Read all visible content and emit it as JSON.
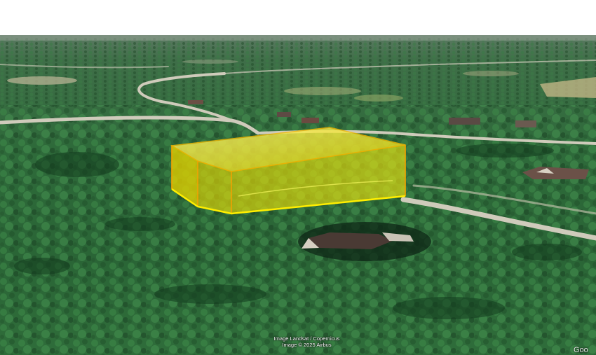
{
  "map": {
    "imagery": "aerial-forest",
    "overlay": {
      "shape": "extruded-polygon",
      "fill_color": "#f2e600",
      "edge_color": "#f5b800"
    },
    "attribution": {
      "line1": "Image Landsat / Copernicus",
      "line2": "Image © 2025 Airbus"
    },
    "brand_text": "Goo"
  },
  "colors": {
    "sky": "#ffffff",
    "forest": "#2f6b3b",
    "road": "#c9c6b8"
  }
}
